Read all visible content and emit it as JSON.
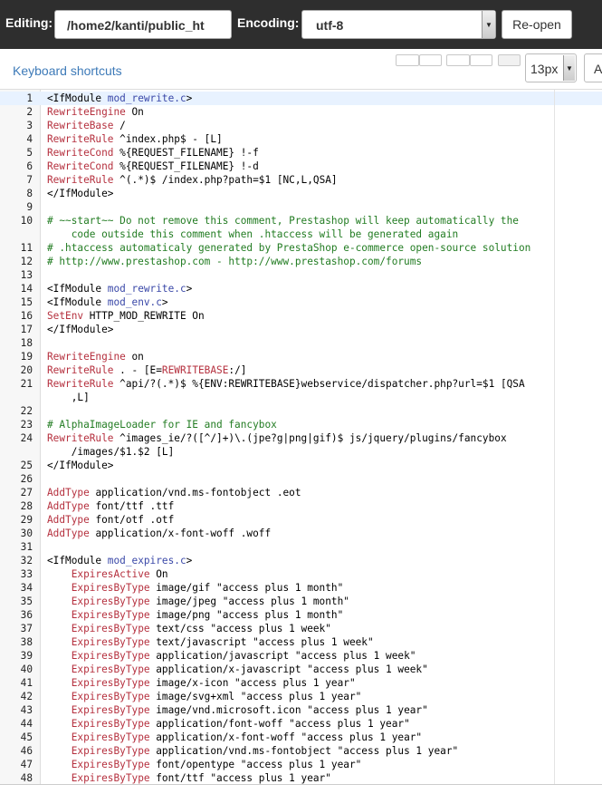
{
  "topbar": {
    "editing_label": "Editing:",
    "path_value": "/home2/kanti/public_ht",
    "encoding_label": "Encoding:",
    "encoding_value": "utf-8",
    "reopen_label": "Re-open"
  },
  "toolbar": {
    "keyboard_shortcuts": "Keyboard shortcuts",
    "font_size": "13px",
    "cut_button_label": "A"
  },
  "editor": {
    "lines": [
      {
        "n": "1",
        "t": [
          [
            "<IfModule ",
            ""
          ],
          [
            "mod_rewrite.c",
            "mod"
          ],
          [
            ">",
            ""
          ]
        ]
      },
      {
        "n": "2",
        "t": [
          [
            "RewriteEngine",
            "dir"
          ],
          [
            " On",
            ""
          ]
        ]
      },
      {
        "n": "3",
        "t": [
          [
            "RewriteBase",
            "dir"
          ],
          [
            " /",
            ""
          ]
        ]
      },
      {
        "n": "4",
        "t": [
          [
            "RewriteRule",
            "dir"
          ],
          [
            " ^index.php$ - [L]",
            ""
          ]
        ]
      },
      {
        "n": "5",
        "t": [
          [
            "RewriteCond",
            "dir"
          ],
          [
            " %{REQUEST_FILENAME} !-f",
            ""
          ]
        ]
      },
      {
        "n": "6",
        "t": [
          [
            "RewriteCond",
            "dir"
          ],
          [
            " %{REQUEST_FILENAME} !-d",
            ""
          ]
        ]
      },
      {
        "n": "7",
        "t": [
          [
            "RewriteRule",
            "dir"
          ],
          [
            " ^(.*)$ /index.php?path=$1 [NC,L,QSA]",
            ""
          ]
        ]
      },
      {
        "n": "8",
        "t": [
          [
            "</IfModule>",
            ""
          ]
        ]
      },
      {
        "n": "9",
        "t": []
      },
      {
        "n": "10",
        "t": [
          [
            "# ~~start~~ Do not remove this comment, Prestashop will keep automatically the",
            "cmt"
          ]
        ]
      },
      {
        "n": "",
        "t": [
          [
            "    code outside this comment when .htaccess will be generated again",
            "cmt"
          ]
        ]
      },
      {
        "n": "11",
        "t": [
          [
            "# .htaccess automaticaly generated by PrestaShop e-commerce open-source solution",
            "cmt"
          ]
        ]
      },
      {
        "n": "12",
        "t": [
          [
            "# http://www.prestashop.com - http://www.prestashop.com/forums",
            "cmt"
          ]
        ]
      },
      {
        "n": "13",
        "t": []
      },
      {
        "n": "14",
        "t": [
          [
            "<IfModule ",
            ""
          ],
          [
            "mod_rewrite.c",
            "mod"
          ],
          [
            ">",
            ""
          ]
        ]
      },
      {
        "n": "15",
        "t": [
          [
            "<IfModule ",
            ""
          ],
          [
            "mod_env.c",
            "mod"
          ],
          [
            ">",
            ""
          ]
        ]
      },
      {
        "n": "16",
        "t": [
          [
            "SetEnv",
            "dir"
          ],
          [
            " HTTP_MOD_REWRITE On",
            ""
          ]
        ]
      },
      {
        "n": "17",
        "t": [
          [
            "</IfModule>",
            ""
          ]
        ]
      },
      {
        "n": "18",
        "t": []
      },
      {
        "n": "19",
        "t": [
          [
            "RewriteEngine",
            "dir"
          ],
          [
            " on",
            ""
          ]
        ]
      },
      {
        "n": "20",
        "t": [
          [
            "RewriteRule",
            "dir"
          ],
          [
            " . - [E=",
            ""
          ],
          [
            "REWRITEBASE",
            "dir"
          ],
          [
            ":/]",
            ""
          ]
        ]
      },
      {
        "n": "21",
        "t": [
          [
            "RewriteRule",
            "dir"
          ],
          [
            " ^api/?(.*)$ %{ENV:REWRITEBASE}webservice/dispatcher.php?url=$1 [QSA",
            ""
          ]
        ]
      },
      {
        "n": "",
        "t": [
          [
            "    ,L]",
            ""
          ]
        ]
      },
      {
        "n": "22",
        "t": []
      },
      {
        "n": "23",
        "t": [
          [
            "# AlphaImageLoader for IE and fancybox",
            "cmt"
          ]
        ]
      },
      {
        "n": "24",
        "t": [
          [
            "RewriteRule",
            "dir"
          ],
          [
            " ^images_ie/?([^/]+)\\.(jpe?g|png|gif)$ js/jquery/plugins/fancybox",
            ""
          ]
        ]
      },
      {
        "n": "",
        "t": [
          [
            "    /images/$1.$2 [L]",
            ""
          ]
        ]
      },
      {
        "n": "25",
        "t": [
          [
            "</IfModule>",
            ""
          ]
        ]
      },
      {
        "n": "26",
        "t": []
      },
      {
        "n": "27",
        "t": [
          [
            "AddType",
            "dir"
          ],
          [
            " application/vnd.ms-fontobject .eot",
            ""
          ]
        ]
      },
      {
        "n": "28",
        "t": [
          [
            "AddType",
            "dir"
          ],
          [
            " font/ttf .ttf",
            ""
          ]
        ]
      },
      {
        "n": "29",
        "t": [
          [
            "AddType",
            "dir"
          ],
          [
            " font/otf .otf",
            ""
          ]
        ]
      },
      {
        "n": "30",
        "t": [
          [
            "AddType",
            "dir"
          ],
          [
            " application/x-font-woff .woff",
            ""
          ]
        ]
      },
      {
        "n": "31",
        "t": []
      },
      {
        "n": "32",
        "t": [
          [
            "<IfModule ",
            ""
          ],
          [
            "mod_expires.c",
            "mod"
          ],
          [
            ">",
            ""
          ]
        ]
      },
      {
        "n": "33",
        "t": [
          [
            "    ",
            ""
          ],
          [
            "ExpiresActive",
            "dir"
          ],
          [
            " On",
            ""
          ]
        ]
      },
      {
        "n": "34",
        "t": [
          [
            "    ",
            ""
          ],
          [
            "ExpiresByType",
            "dir"
          ],
          [
            " image/gif \"access plus 1 month\"",
            ""
          ]
        ]
      },
      {
        "n": "35",
        "t": [
          [
            "    ",
            ""
          ],
          [
            "ExpiresByType",
            "dir"
          ],
          [
            " image/jpeg \"access plus 1 month\"",
            ""
          ]
        ]
      },
      {
        "n": "36",
        "t": [
          [
            "    ",
            ""
          ],
          [
            "ExpiresByType",
            "dir"
          ],
          [
            " image/png \"access plus 1 month\"",
            ""
          ]
        ]
      },
      {
        "n": "37",
        "t": [
          [
            "    ",
            ""
          ],
          [
            "ExpiresByType",
            "dir"
          ],
          [
            " text/css \"access plus 1 week\"",
            ""
          ]
        ]
      },
      {
        "n": "38",
        "t": [
          [
            "    ",
            ""
          ],
          [
            "ExpiresByType",
            "dir"
          ],
          [
            " text/javascript \"access plus 1 week\"",
            ""
          ]
        ]
      },
      {
        "n": "39",
        "t": [
          [
            "    ",
            ""
          ],
          [
            "ExpiresByType",
            "dir"
          ],
          [
            " application/javascript \"access plus 1 week\"",
            ""
          ]
        ]
      },
      {
        "n": "40",
        "t": [
          [
            "    ",
            ""
          ],
          [
            "ExpiresByType",
            "dir"
          ],
          [
            " application/x-javascript \"access plus 1 week\"",
            ""
          ]
        ]
      },
      {
        "n": "41",
        "t": [
          [
            "    ",
            ""
          ],
          [
            "ExpiresByType",
            "dir"
          ],
          [
            " image/x-icon \"access plus 1 year\"",
            ""
          ]
        ]
      },
      {
        "n": "42",
        "t": [
          [
            "    ",
            ""
          ],
          [
            "ExpiresByType",
            "dir"
          ],
          [
            " image/svg+xml \"access plus 1 year\"",
            ""
          ]
        ]
      },
      {
        "n": "43",
        "t": [
          [
            "    ",
            ""
          ],
          [
            "ExpiresByType",
            "dir"
          ],
          [
            " image/vnd.microsoft.icon \"access plus 1 year\"",
            ""
          ]
        ]
      },
      {
        "n": "44",
        "t": [
          [
            "    ",
            ""
          ],
          [
            "ExpiresByType",
            "dir"
          ],
          [
            " application/font-woff \"access plus 1 year\"",
            ""
          ]
        ]
      },
      {
        "n": "45",
        "t": [
          [
            "    ",
            ""
          ],
          [
            "ExpiresByType",
            "dir"
          ],
          [
            " application/x-font-woff \"access plus 1 year\"",
            ""
          ]
        ]
      },
      {
        "n": "46",
        "t": [
          [
            "    ",
            ""
          ],
          [
            "ExpiresByType",
            "dir"
          ],
          [
            " application/vnd.ms-fontobject \"access plus 1 year\"",
            ""
          ]
        ]
      },
      {
        "n": "47",
        "t": [
          [
            "    ",
            ""
          ],
          [
            "ExpiresByType",
            "dir"
          ],
          [
            " font/opentype \"access plus 1 year\"",
            ""
          ]
        ]
      },
      {
        "n": "48",
        "t": [
          [
            "    ",
            ""
          ],
          [
            "ExpiresByType",
            "dir"
          ],
          [
            " font/ttf \"access plus 1 year\"",
            ""
          ]
        ]
      }
    ]
  }
}
